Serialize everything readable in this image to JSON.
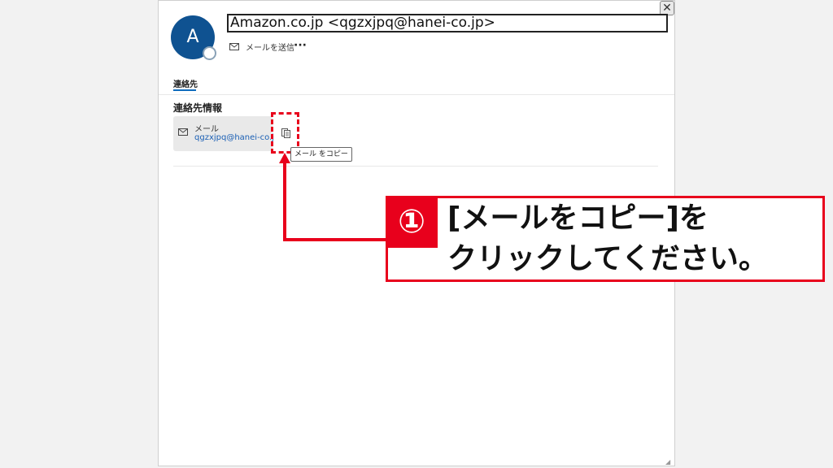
{
  "contact": {
    "initial": "A",
    "display_name": "Amazon.co.jp <qgzxjpq@hanei-co.jp>",
    "send_mail_label": "メールを送信",
    "more_label": "···"
  },
  "tabs": [
    {
      "label": "連絡先"
    }
  ],
  "section": {
    "title": "連絡先情報",
    "email_label": "メール",
    "email_value": "qgzxjpq@hanei-co.jp",
    "copy_tooltip": "メール をコピー"
  },
  "callout": {
    "number": "①",
    "line1": "[メールをコピー]を",
    "line2": "クリックしてください。"
  },
  "colors": {
    "accent_red": "#e8001c",
    "avatar_blue": "#0f5291",
    "link_blue": "#1a5fb4"
  },
  "window": {
    "close_label": "✕"
  }
}
